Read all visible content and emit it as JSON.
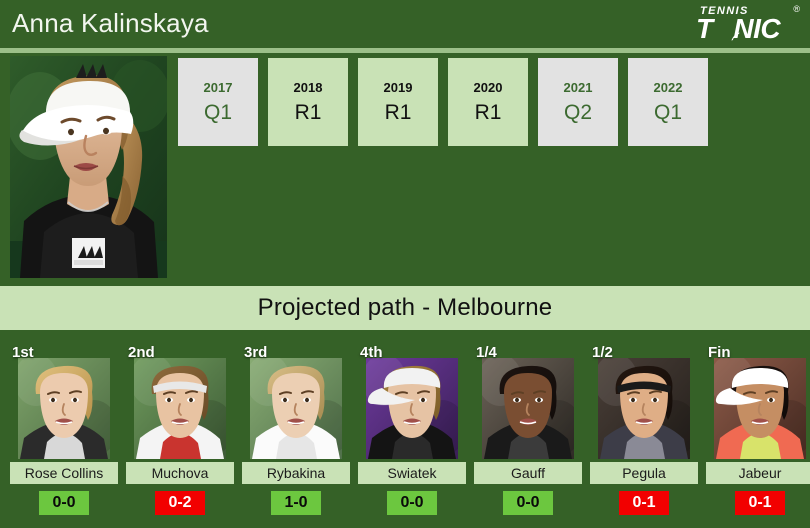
{
  "header": {
    "player_name": "Anna Kalinskaya",
    "logo": {
      "top_text": "TENNIS",
      "main_text_before": "T",
      "main_text_after": "NIC",
      "registered_mark": "®",
      "ball_color": "#d4e03a"
    }
  },
  "profile": {
    "photo_alt": "Anna Kalinskaya portrait"
  },
  "history": {
    "entries": [
      {
        "year": "2017",
        "result": "Q1",
        "style": "gray"
      },
      {
        "year": "2018",
        "result": "R1",
        "style": "green"
      },
      {
        "year": "2019",
        "result": "R1",
        "style": "green"
      },
      {
        "year": "2020",
        "result": "R1",
        "style": "green"
      },
      {
        "year": "2021",
        "result": "Q2",
        "style": "gray"
      },
      {
        "year": "2022",
        "result": "Q1",
        "style": "gray"
      }
    ]
  },
  "section": {
    "title": "Projected path - Melbourne"
  },
  "path": {
    "cards": [
      {
        "round": "1st",
        "name": "Rose Collins",
        "score": "0-0",
        "score_style": "pos"
      },
      {
        "round": "2nd",
        "name": "Muchova",
        "score": "0-2",
        "score_style": "neg"
      },
      {
        "round": "3rd",
        "name": "Rybakina",
        "score": "1-0",
        "score_style": "pos"
      },
      {
        "round": "4th",
        "name": "Swiatek",
        "score": "0-0",
        "score_style": "pos"
      },
      {
        "round": "1/4",
        "name": "Gauff",
        "score": "0-0",
        "score_style": "pos"
      },
      {
        "round": "1/2",
        "name": "Pegula",
        "score": "0-1",
        "score_style": "neg"
      },
      {
        "round": "Fin",
        "name": "Jabeur",
        "score": "0-1",
        "score_style": "neg"
      }
    ]
  },
  "colors": {
    "background_green": "#356127",
    "light_green": "#c9e2b6",
    "gray_box": "#e2e2e2",
    "score_win": "#6cc73f",
    "score_loss": "#f20000",
    "rule_line": "#9cc089"
  }
}
